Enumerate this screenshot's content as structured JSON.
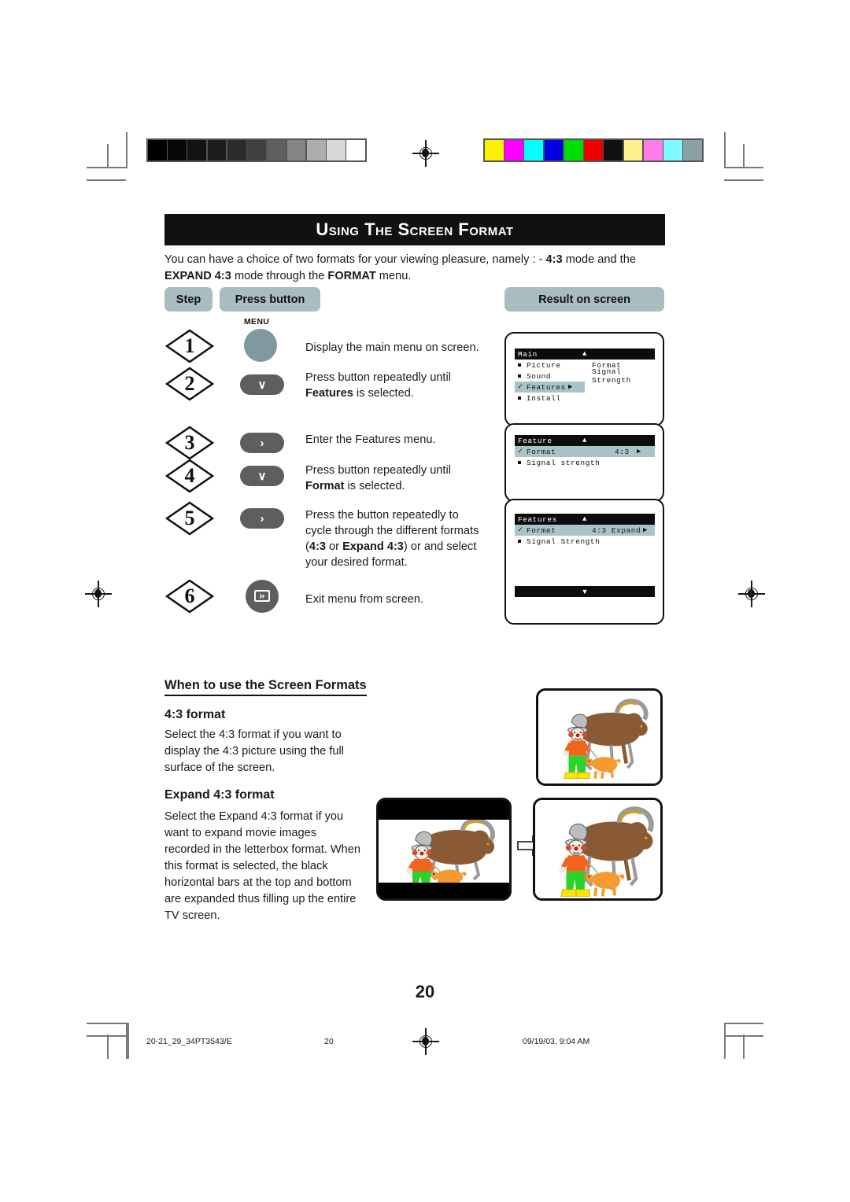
{
  "page": {
    "title": "Using the Screen Format",
    "number": "20"
  },
  "intro": {
    "line1_a": "You can have a choice of two formats for your viewing pleasure, namely : - ",
    "line1_b": "4:3",
    "line1_c": " mode and the",
    "line2_a": "EXPAND 4:3",
    "line2_b": " mode through the ",
    "line2_c": "FORMAT",
    "line2_d": " menu."
  },
  "table_headers": {
    "step": "Step",
    "press_button": "Press button",
    "result_on_screen": "Result on screen"
  },
  "steps": [
    {
      "number": "1",
      "button_label": "MENU",
      "button_type": "round-menu",
      "text_plain": "Display the main menu on screen."
    },
    {
      "number": "2",
      "button_type": "pill-down",
      "glyph": "∨",
      "text_line1": "Press button repeatedly until",
      "text_bold": "Features",
      "text_line2_rest": " is selected."
    },
    {
      "number": "3",
      "button_type": "pill-right",
      "glyph": "›",
      "text_plain": "Enter the Features menu."
    },
    {
      "number": "4",
      "button_type": "pill-down",
      "glyph": "∨",
      "text_line1": "Press button repeatedly until",
      "text_bold": "Format",
      "text_line2_rest": " is selected."
    },
    {
      "number": "5",
      "button_type": "pill-right",
      "glyph": "›",
      "text_line1": "Press the button repeatedly to",
      "text_line2": "cycle through the different formats",
      "text_line3_a": "(",
      "text_line3_b": "4:3",
      "text_line3_c": " or ",
      "text_line3_d": "Expand 4:3",
      "text_line3_e": ") or and select",
      "text_line4": "your desired format."
    },
    {
      "number": "6",
      "button_type": "round-iplus",
      "glyph": "i+",
      "text_plain": "Exit menu from screen."
    }
  ],
  "osd_panels": [
    {
      "id": "main-menu",
      "title": "Main",
      "title_caret": "▲",
      "rows": [
        {
          "marker": "square",
          "label": "Picture",
          "right": "Format"
        },
        {
          "marker": "square",
          "label": "Sound",
          "right": "Signal Strength"
        },
        {
          "marker": "check",
          "label": "Features",
          "right": "",
          "arrow": "▶",
          "highlighted": true
        },
        {
          "marker": "square",
          "label": "Install",
          "right": ""
        }
      ]
    },
    {
      "id": "feature-menu",
      "title": "Feature",
      "title_caret": "▲",
      "rows": [
        {
          "marker": "check",
          "label": "Format",
          "right": "4:3",
          "arrow": "▶",
          "highlighted": true
        },
        {
          "marker": "square",
          "label": "Signal strength",
          "right": ""
        }
      ]
    },
    {
      "id": "features-menu",
      "title": "Features",
      "title_caret": "▲",
      "rows": [
        {
          "marker": "check",
          "label": "Format",
          "right": "4:3 Expand",
          "arrow": "▶",
          "highlighted": true
        },
        {
          "marker": "square",
          "label": "Signal Strength",
          "right": ""
        }
      ],
      "bottom_bar_caret": "▼"
    }
  ],
  "lower": {
    "heading": "When to use the Screen Formats",
    "section1": {
      "heading": "4:3 format",
      "body": "Select the 4:3 format if you want to display the 4:3 picture using the full surface of the screen."
    },
    "section2": {
      "heading": "Expand 4:3 format",
      "body": "Select the Expand 4:3 format if you want to expand movie images recorded in the letterbox format. When this format is selected, the black horizontal bars at the top and bottom are expanded thus filling up the entire TV screen."
    }
  },
  "footer": {
    "file": "20-21_29_34PT3543/E",
    "page": "20",
    "timestamp": "09/19/03, 9:04 AM"
  },
  "colors": {
    "banner_bg": "#111111",
    "pill_bg": "#a9bdc0",
    "menu_button": "#8099a0",
    "nav_button": "#5e5e5e",
    "osd_highlight": "#a9c4c9",
    "osd_title_bg": "#0c0c0c"
  },
  "color_bar": {
    "gray_ramp": [
      "#000000",
      "#080808",
      "#131313",
      "#1d1d1d",
      "#2b2b2b",
      "#3f3f3f",
      "#5e5e5e",
      "#858585",
      "#adadad",
      "#d8d8d8",
      "#ffffff"
    ],
    "colors": [
      "#fff200",
      "#ff00ff",
      "#00ffff",
      "#0000e0",
      "#00e000",
      "#ee0000",
      "#111111",
      "#fdf08a",
      "#ff7de8",
      "#7df9ff",
      "#8c9fa6"
    ]
  }
}
